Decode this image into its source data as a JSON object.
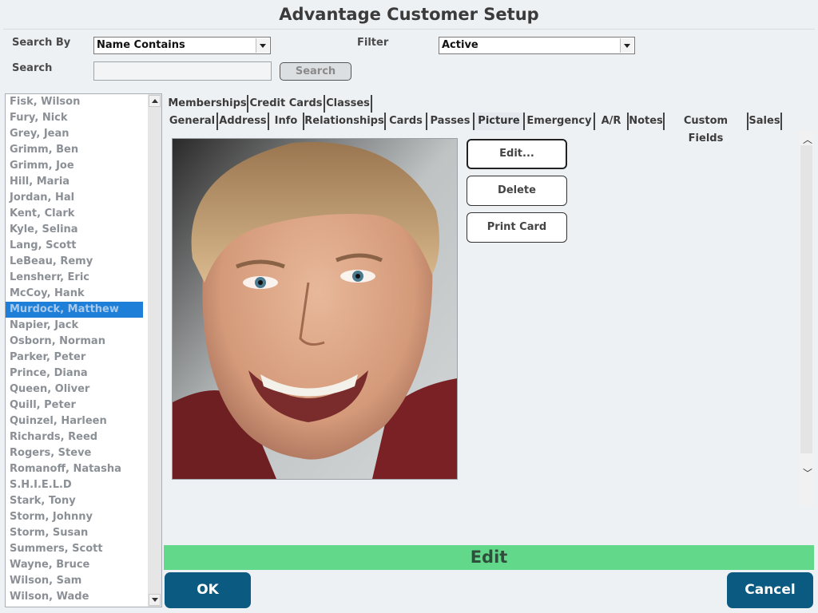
{
  "window": {
    "title": "Advantage Customer Setup"
  },
  "search": {
    "search_by_label": "Search By",
    "search_by_value": "Name Contains",
    "filter_label": "Filter",
    "filter_value": "Active",
    "search_label": "Search",
    "search_input_value": "",
    "search_button": "Search"
  },
  "customers": [
    "Fisk, Wilson",
    "Fury, Nick",
    "Grey, Jean",
    "Grimm, Ben",
    "Grimm, Joe",
    "Hill, Maria",
    "Jordan, Hal",
    "Kent, Clark",
    "Kyle, Selina",
    "Lang, Scott",
    "LeBeau, Remy",
    "Lensherr, Eric",
    "McCoy, Hank",
    "Murdock, Matthew",
    "Napier, Jack",
    "Osborn, Norman",
    "Parker, Peter",
    "Prince, Diana",
    "Queen, Oliver",
    "Quill, Peter",
    "Quinzel, Harleen",
    "Richards, Reed",
    "Rogers, Steve",
    "Romanoff, Natasha",
    "S.H.I.E.L.D",
    "Stark, Tony",
    "Storm, Johnny",
    "Storm, Susan",
    "Summers, Scott",
    "Wayne, Bruce",
    "Wilson, Sam",
    "Wilson, Wade"
  ],
  "selected_customer": "Murdock, Matthew",
  "tabs_row1": [
    "Memberships",
    "Credit Cards",
    "Classes"
  ],
  "tabs_row2": [
    "General",
    "Address",
    "Info",
    "Relationships",
    "Cards",
    "Passes",
    "Picture",
    "Emergency",
    "A/R",
    "Notes",
    "Custom Fields",
    "Sales"
  ],
  "active_tab": "Picture",
  "picture_actions": {
    "edit": "Edit...",
    "delete": "Delete",
    "print_card": "Print Card"
  },
  "status": {
    "mode": "Edit"
  },
  "footer": {
    "ok": "OK",
    "cancel": "Cancel"
  },
  "colors": {
    "accent": "#0b5a82",
    "status_bar": "#62d98a",
    "selection": "#1e7fd8"
  },
  "icons": [
    "chevron-down-icon",
    "scroll-up-icon",
    "scroll-down-icon"
  ]
}
